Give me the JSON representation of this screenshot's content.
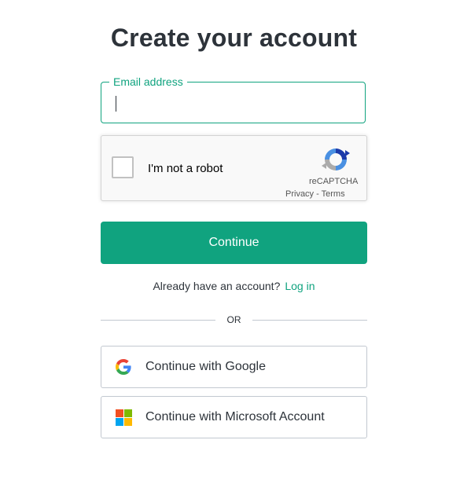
{
  "title": "Create your account",
  "email": {
    "label": "Email address",
    "value": "",
    "placeholder": ""
  },
  "captcha": {
    "label": "I'm not a robot",
    "brand": "reCAPTCHA",
    "privacy": "Privacy",
    "separator": " - ",
    "terms": "Terms",
    "checked": false
  },
  "continue_label": "Continue",
  "login": {
    "prompt": "Already have an account?",
    "link": "Log in"
  },
  "divider_text": "OR",
  "social": {
    "google_label": "Continue with Google",
    "microsoft_label": "Continue with Microsoft Account"
  },
  "colors": {
    "accent": "#10a37f",
    "text": "#2d333a",
    "border": "#c2c8d0"
  },
  "icons": {
    "google": "google-g-icon",
    "microsoft": "microsoft-logo-icon",
    "recaptcha": "recaptcha-logo-icon"
  }
}
